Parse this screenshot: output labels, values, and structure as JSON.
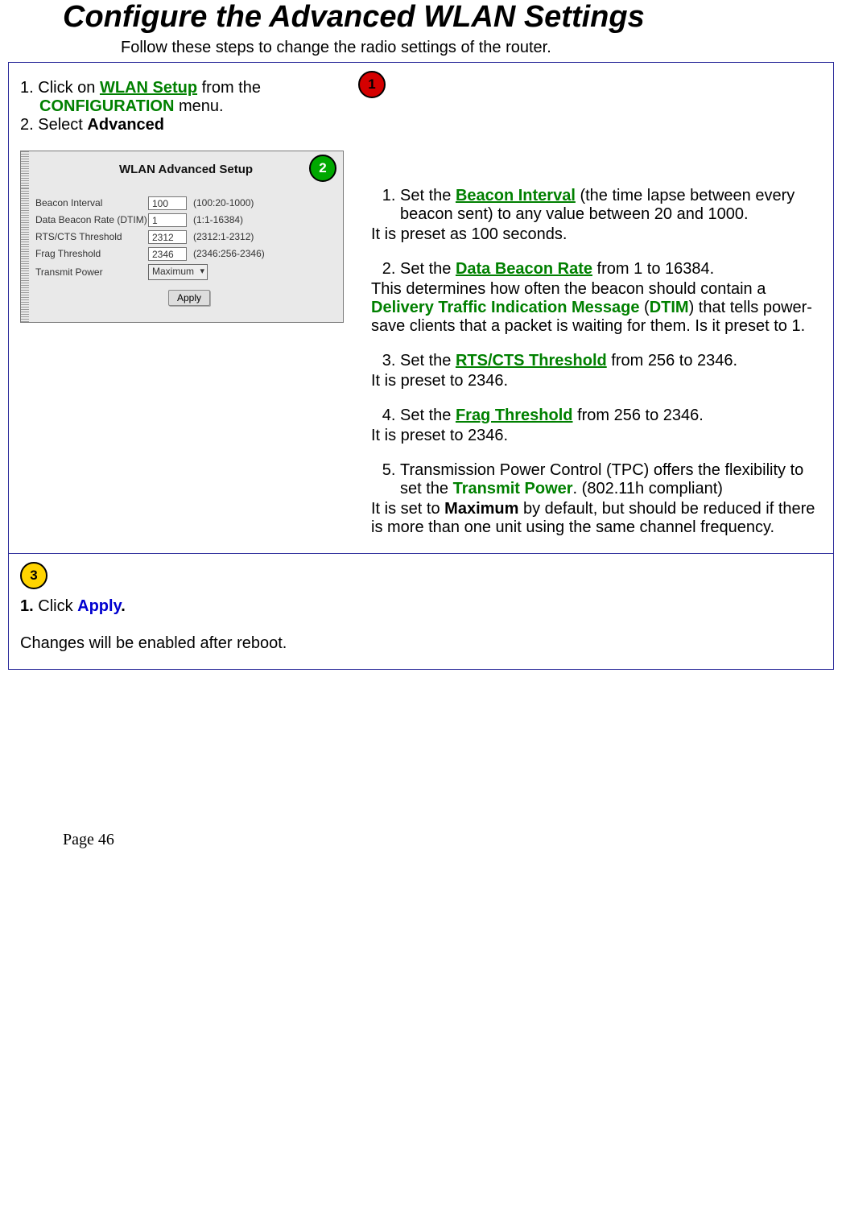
{
  "title": "Configure the Advanced WLAN Settings",
  "intro": "Follow these steps to change the radio settings of the router.",
  "markers": {
    "one": "1",
    "two": "2",
    "three": "3"
  },
  "step1": {
    "num1": "1.",
    "t1a": "Click on ",
    "t1b": "WLAN Setup",
    "t1c": " from the ",
    "t1d": "CONFIGURATION",
    "t1e": " menu.",
    "num2": "2.",
    "t2a": "Select ",
    "t2b": "Advanced"
  },
  "mock": {
    "title": "WLAN Advanced Setup",
    "fields": {
      "beacon_label": "Beacon Interval",
      "beacon_value": "100",
      "beacon_hint": "(100:20-1000)",
      "dtim_label": "Data Beacon Rate (DTIM)",
      "dtim_value": "1",
      "dtim_hint": "(1:1-16384)",
      "rts_label": "RTS/CTS Threshold",
      "rts_value": "2312",
      "rts_hint": "(2312:1-2312)",
      "frag_label": "Frag Threshold",
      "frag_value": "2346",
      "frag_hint": "(2346:256-2346)",
      "txpower_label": "Transmit Power",
      "txpower_value": "Maximum"
    },
    "apply": "Apply"
  },
  "right": {
    "r1a": "Set the ",
    "r1b": "Beacon Interval",
    "r1c": " (the time lapse between every beacon sent) to any value between 20 and 1000.",
    "r1p": "It is preset as 100 seconds.",
    "r2a": "Set the ",
    "r2b": "Data Beacon Rate",
    "r2c": " from 1 to 16384.",
    "r2p_a": "This determines how often the beacon should contain a ",
    "r2p_b": "Delivery Traffic Indication Message",
    "r2p_c": " (",
    "r2p_d": "DTIM",
    "r2p_e": ") that tells power-save clients that a packet is waiting for them. Is it preset to 1.",
    "r3a": "Set the ",
    "r3b": "RTS/CTS Threshold",
    "r3c": " from 256 to 2346.",
    "r3p": "It is preset to 2346.",
    "r4a": "Set the ",
    "r4b": "Frag Threshold",
    "r4c": " from 256 to 2346.",
    "r4p": "It is preset to 2346.",
    "r5a": "Transmission Power Control (TPC) offers the flexibility to set the ",
    "r5b": "Transmit Power",
    "r5c": ". (802.11h compliant)",
    "r5p_a": "It is set to ",
    "r5p_b": "Maximum",
    "r5p_c": " by default, but should be reduced if there is more than one unit using the same channel frequency."
  },
  "bottom": {
    "num": "1.",
    "a": "Click ",
    "b": "Apply",
    "c": ".",
    "p": "Changes will be enabled after reboot."
  },
  "footer": "Page 46"
}
